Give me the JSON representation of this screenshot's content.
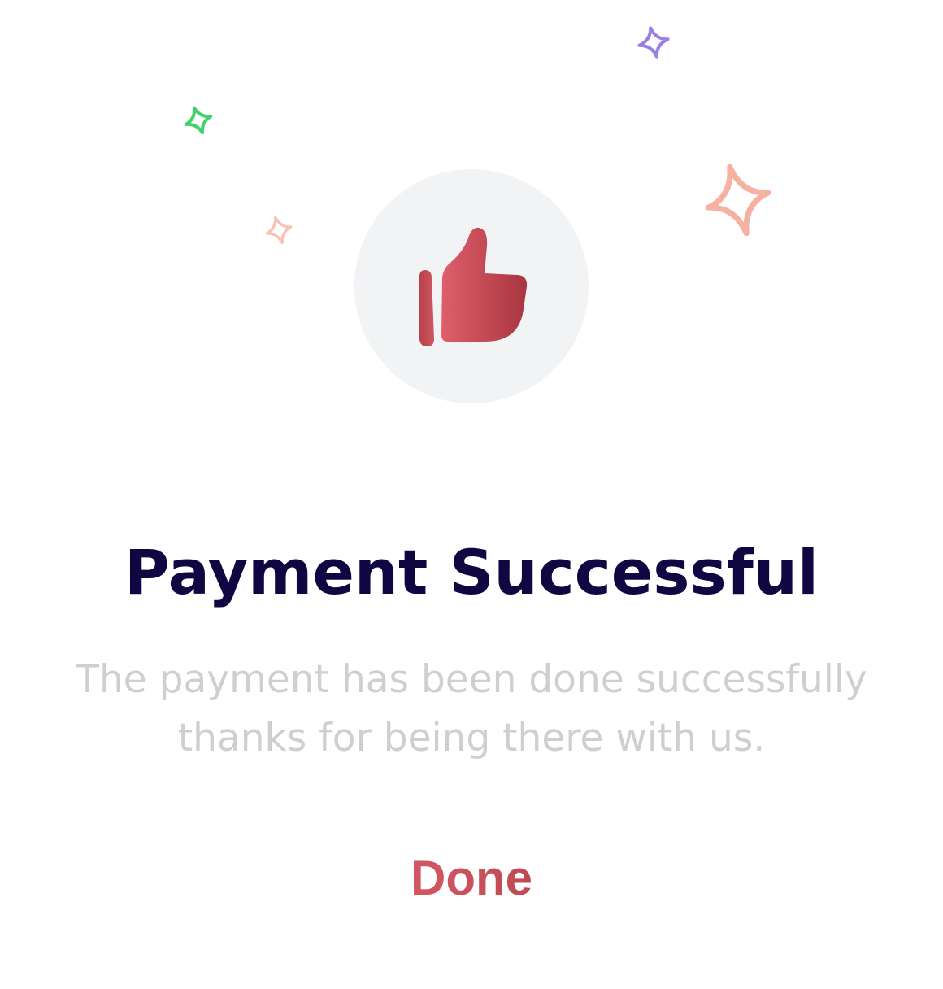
{
  "colors": {
    "title": "#0f0742",
    "message": "#cfcfd1",
    "accent_start": "#de5f6b",
    "accent_end": "#b5424b",
    "icon_background": "#f2f3f5",
    "sparkle_purple": "#9b7fe6",
    "sparkle_green": "#3fd46b",
    "sparkle_peach": "#f7b1a0",
    "sparkle_light_peach": "#f8c3b6"
  },
  "icons": {
    "main": "thumbs-up-icon",
    "decorations": [
      "sparkle-icon",
      "sparkle-icon",
      "sparkle-icon",
      "sparkle-icon"
    ]
  },
  "dialog": {
    "title": "Payment Successful",
    "message_line1": "The payment has been done successfully",
    "message_line2": "thanks for being there with us.",
    "done_label": "Done"
  }
}
